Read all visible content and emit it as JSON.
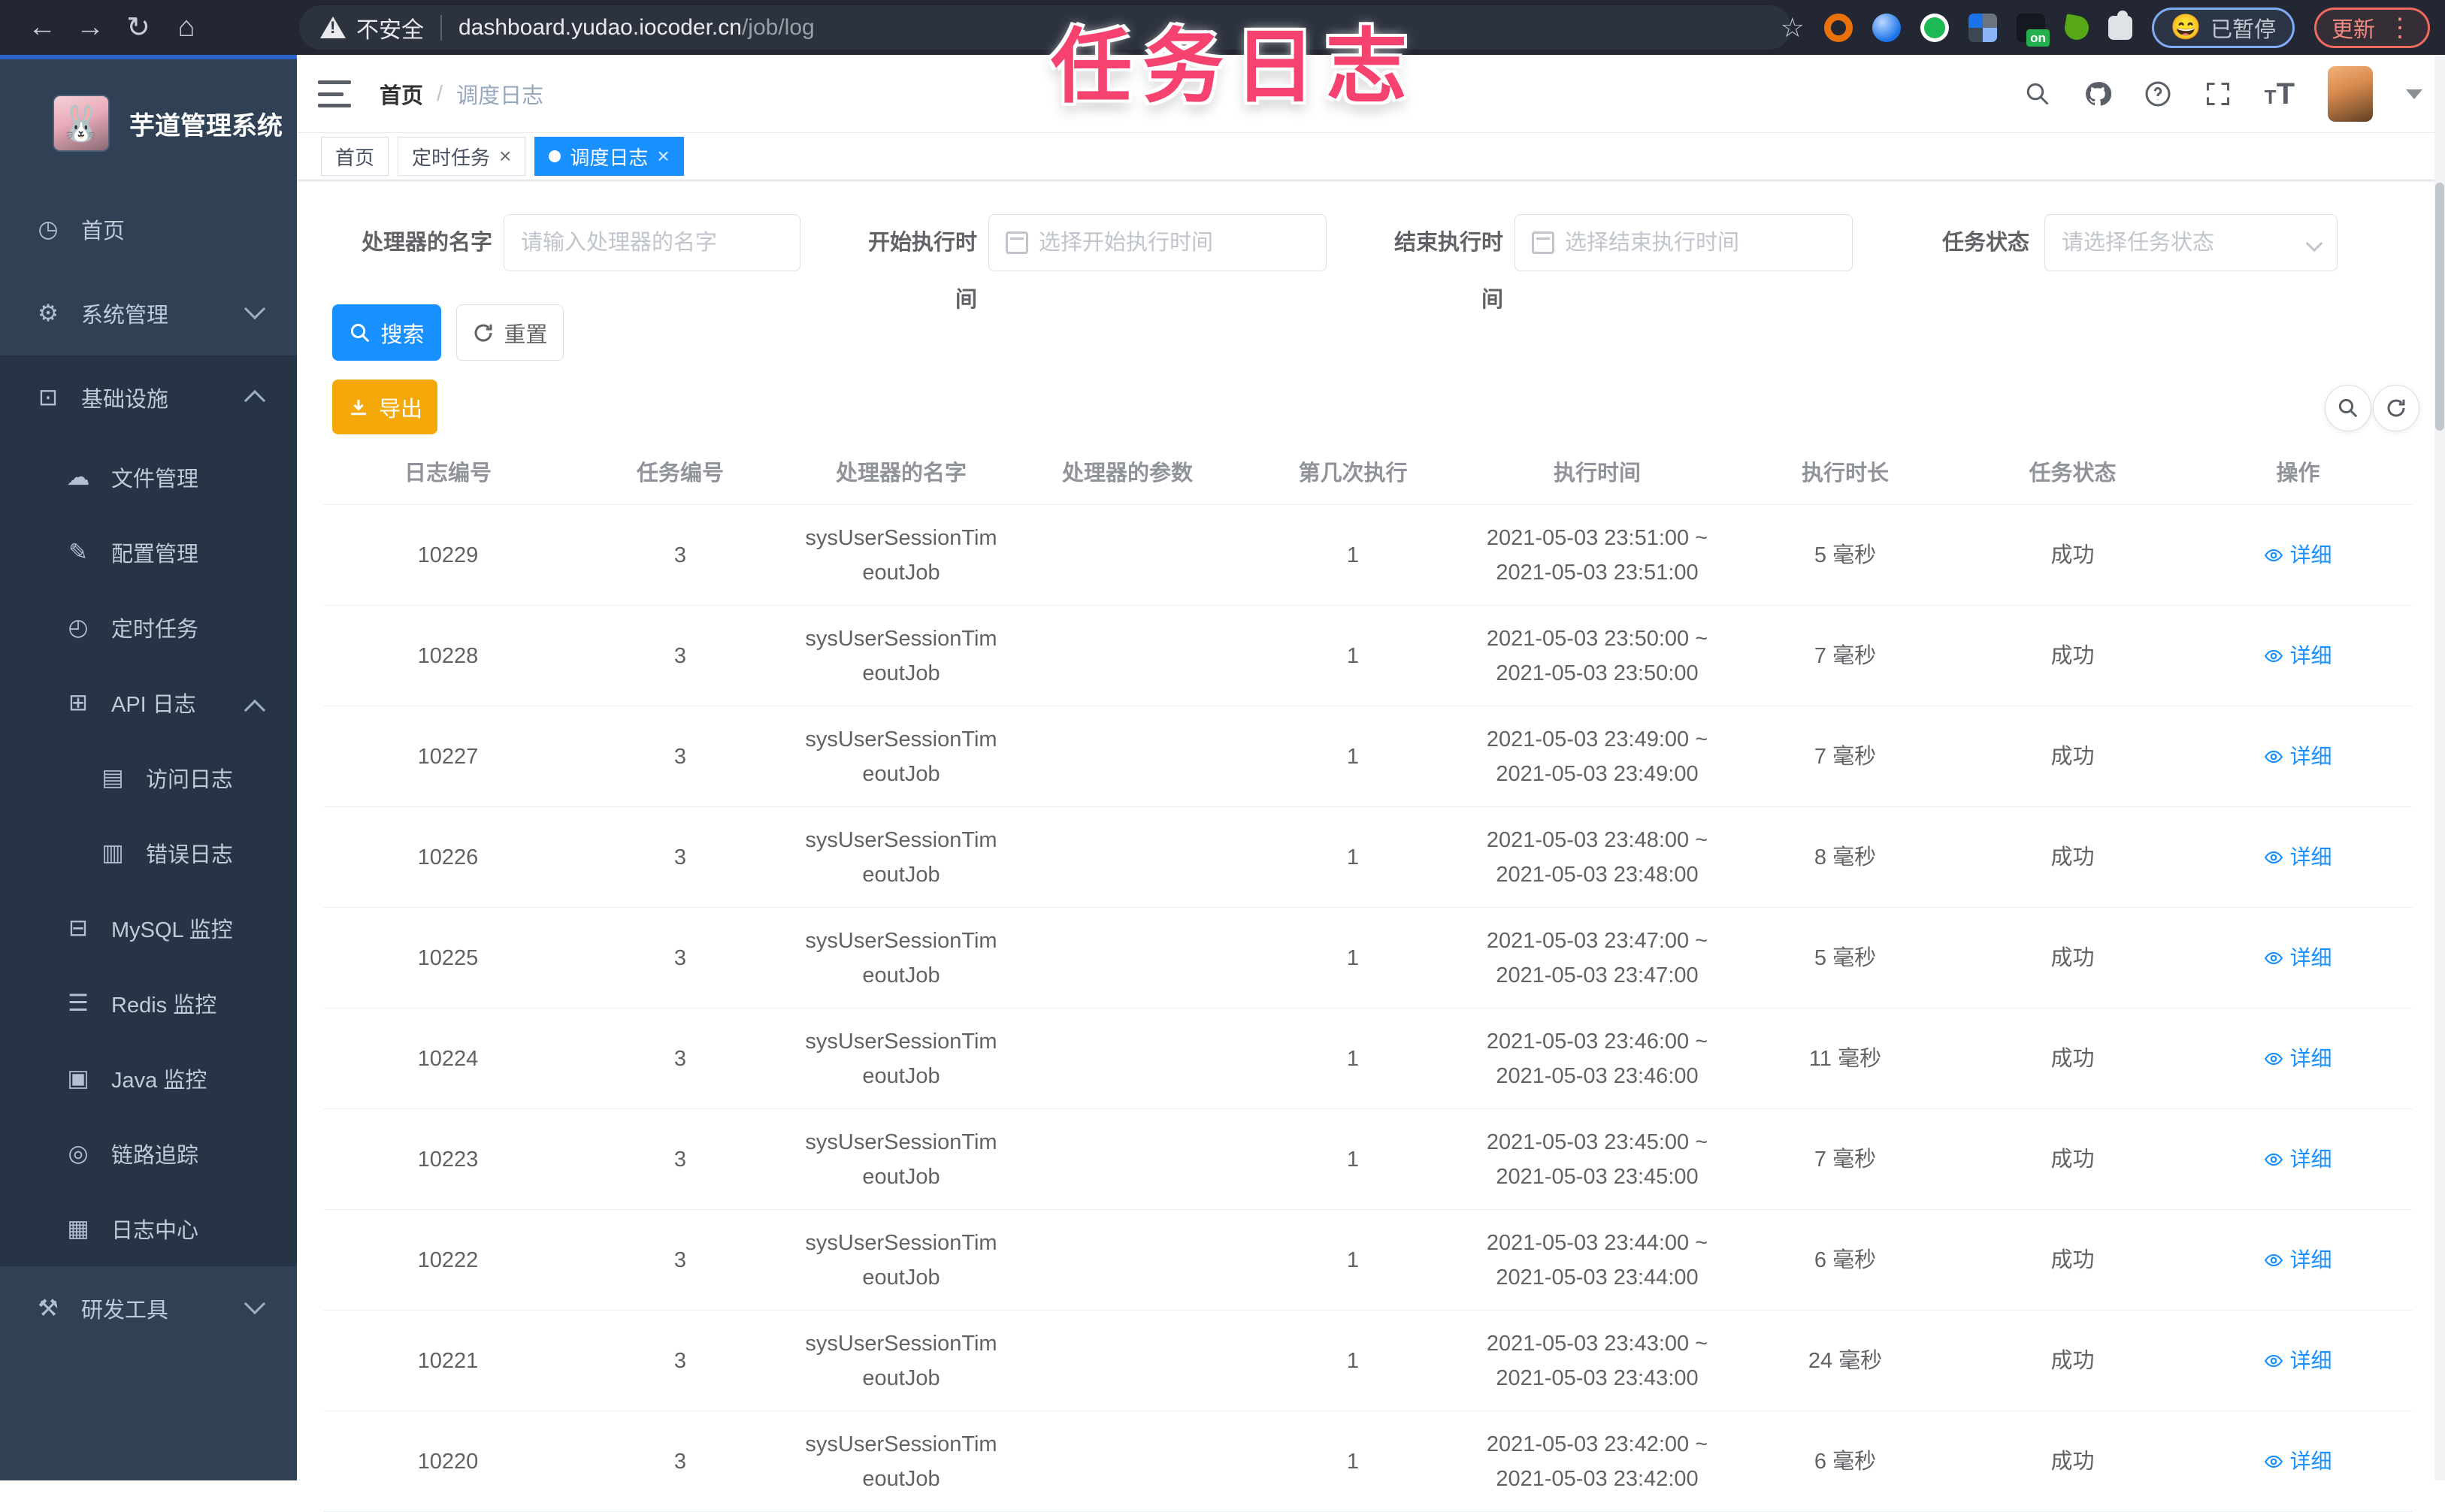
{
  "annotation": {
    "text": "任务日志"
  },
  "chrome": {
    "security_label": "不安全",
    "url_host": "dashboard.yudao.iocoder.cn",
    "url_path": "/job/log",
    "paused_badge": {
      "emoji": "😄",
      "label": "已暂停"
    },
    "update_label": "更新",
    "extension_on_badge": "on",
    "extensions": [
      {
        "icon": "extension-orange-ring-icon",
        "kind": "ring"
      },
      {
        "icon": "extension-blue-bulb-icon",
        "kind": "bulb"
      },
      {
        "icon": "extension-green-y-icon",
        "kind": "y"
      },
      {
        "icon": "extension-grid-icon",
        "kind": "grid"
      },
      {
        "icon": "extension-on-badge-icon",
        "kind": "on"
      },
      {
        "icon": "extension-leaf-icon",
        "kind": "leaf"
      },
      {
        "icon": "extensions-puzzle-icon",
        "kind": "puzzle"
      }
    ]
  },
  "glyphs": {
    "back": "←",
    "forward": "→",
    "reload": "↻",
    "home": "⌂",
    "star": "☆",
    "kebab": "⋮",
    "close": "×",
    "refresh": "↻",
    "t_small": "T",
    "t_big": "T"
  },
  "sidebar": {
    "logo_title": "芋道管理系统",
    "logo_glyph": "🐰",
    "items": [
      {
        "name": "home",
        "icon": "gauge-icon",
        "glyph": "◷",
        "label": "首页",
        "level": 0,
        "chevron": "",
        "dark": false
      },
      {
        "name": "system",
        "icon": "gear-icon",
        "glyph": "⚙",
        "label": "系统管理",
        "level": 0,
        "chevron": "down",
        "dark": false
      },
      {
        "name": "infra",
        "icon": "monitor-icon",
        "glyph": "⊡",
        "label": "基础设施",
        "level": 0,
        "chevron": "up",
        "dark": true
      },
      {
        "name": "file",
        "icon": "cloud-upload-icon",
        "glyph": "☁",
        "label": "文件管理",
        "level": 1,
        "chevron": "",
        "dark": true
      },
      {
        "name": "config",
        "icon": "edit-icon",
        "glyph": "✎",
        "label": "配置管理",
        "level": 1,
        "chevron": "",
        "dark": true
      },
      {
        "name": "cron-job",
        "icon": "timer-icon",
        "glyph": "◴",
        "label": "定时任务",
        "level": 1,
        "chevron": "",
        "dark": true
      },
      {
        "name": "api-log",
        "icon": "log-icon",
        "glyph": "⊞",
        "label": "API 日志",
        "level": 1,
        "chevron": "up",
        "dark": true
      },
      {
        "name": "access-log",
        "icon": "log-icon",
        "glyph": "▤",
        "label": "访问日志",
        "level": 2,
        "chevron": "",
        "dark": true
      },
      {
        "name": "error-log",
        "icon": "log-icon",
        "glyph": "▥",
        "label": "错误日志",
        "level": 2,
        "chevron": "",
        "dark": true
      },
      {
        "name": "mysql",
        "icon": "database-icon",
        "glyph": "⊟",
        "label": "MySQL 监控",
        "level": 1,
        "chevron": "",
        "dark": true
      },
      {
        "name": "redis",
        "icon": "layers-icon",
        "glyph": "☰",
        "label": "Redis 监控",
        "level": 1,
        "chevron": "",
        "dark": true
      },
      {
        "name": "java",
        "icon": "java-monitor-icon",
        "glyph": "▣",
        "label": "Java 监控",
        "level": 1,
        "chevron": "",
        "dark": true
      },
      {
        "name": "trace",
        "icon": "eye-icon",
        "glyph": "◎",
        "label": "链路追踪",
        "level": 1,
        "chevron": "",
        "dark": true
      },
      {
        "name": "log-center",
        "icon": "log-icon",
        "glyph": "▦",
        "label": "日志中心",
        "level": 1,
        "chevron": "",
        "dark": true
      },
      {
        "name": "devtools",
        "icon": "toolbox-icon",
        "glyph": "⚒",
        "label": "研发工具",
        "level": 0,
        "chevron": "down",
        "dark": false
      }
    ]
  },
  "navbar": {
    "breadcrumb_home": "首页",
    "breadcrumb_sep": "/",
    "breadcrumb_current": "调度日志"
  },
  "tags": [
    {
      "label": "首页",
      "closable": false,
      "active": false
    },
    {
      "label": "定时任务",
      "closable": true,
      "active": false
    },
    {
      "label": "调度日志",
      "closable": true,
      "active": true
    }
  ],
  "filters": {
    "handler_label": "处理器的名字",
    "handler_placeholder": "请输入处理器的名字",
    "begin_label": "开始执行时间",
    "begin_placeholder": "选择开始执行时间",
    "end_label": "结束执行时间",
    "end_placeholder": "选择结束执行时间",
    "status_label": "任务状态",
    "status_placeholder": "请选择任务状态"
  },
  "actions": {
    "search": "搜索",
    "reset": "重置",
    "export": "导出"
  },
  "table": {
    "headers": [
      "日志编号",
      "任务编号",
      "处理器的名字",
      "处理器的参数",
      "第几次执行",
      "执行时间",
      "执行时长",
      "任务状态",
      "操作"
    ],
    "rows": [
      {
        "log_id": "10229",
        "task_id": "3",
        "handler": [
          "sysUserSessionTim",
          "eoutJob"
        ],
        "param": "",
        "count": "1",
        "time": [
          "2021-05-03 23:51:00 ~",
          "2021-05-03 23:51:00"
        ],
        "duration": "5 毫秒",
        "status": "成功",
        "action": "详细"
      },
      {
        "log_id": "10228",
        "task_id": "3",
        "handler": [
          "sysUserSessionTim",
          "eoutJob"
        ],
        "param": "",
        "count": "1",
        "time": [
          "2021-05-03 23:50:00 ~",
          "2021-05-03 23:50:00"
        ],
        "duration": "7 毫秒",
        "status": "成功",
        "action": "详细"
      },
      {
        "log_id": "10227",
        "task_id": "3",
        "handler": [
          "sysUserSessionTim",
          "eoutJob"
        ],
        "param": "",
        "count": "1",
        "time": [
          "2021-05-03 23:49:00 ~",
          "2021-05-03 23:49:00"
        ],
        "duration": "7 毫秒",
        "status": "成功",
        "action": "详细"
      },
      {
        "log_id": "10226",
        "task_id": "3",
        "handler": [
          "sysUserSessionTim",
          "eoutJob"
        ],
        "param": "",
        "count": "1",
        "time": [
          "2021-05-03 23:48:00 ~",
          "2021-05-03 23:48:00"
        ],
        "duration": "8 毫秒",
        "status": "成功",
        "action": "详细"
      },
      {
        "log_id": "10225",
        "task_id": "3",
        "handler": [
          "sysUserSessionTim",
          "eoutJob"
        ],
        "param": "",
        "count": "1",
        "time": [
          "2021-05-03 23:47:00 ~",
          "2021-05-03 23:47:00"
        ],
        "duration": "5 毫秒",
        "status": "成功",
        "action": "详细"
      },
      {
        "log_id": "10224",
        "task_id": "3",
        "handler": [
          "sysUserSessionTim",
          "eoutJob"
        ],
        "param": "",
        "count": "1",
        "time": [
          "2021-05-03 23:46:00 ~",
          "2021-05-03 23:46:00"
        ],
        "duration": "11 毫秒",
        "status": "成功",
        "action": "详细"
      },
      {
        "log_id": "10223",
        "task_id": "3",
        "handler": [
          "sysUserSessionTim",
          "eoutJob"
        ],
        "param": "",
        "count": "1",
        "time": [
          "2021-05-03 23:45:00 ~",
          "2021-05-03 23:45:00"
        ],
        "duration": "7 毫秒",
        "status": "成功",
        "action": "详细"
      },
      {
        "log_id": "10222",
        "task_id": "3",
        "handler": [
          "sysUserSessionTim",
          "eoutJob"
        ],
        "param": "",
        "count": "1",
        "time": [
          "2021-05-03 23:44:00 ~",
          "2021-05-03 23:44:00"
        ],
        "duration": "6 毫秒",
        "status": "成功",
        "action": "详细"
      },
      {
        "log_id": "10221",
        "task_id": "3",
        "handler": [
          "sysUserSessionTim",
          "eoutJob"
        ],
        "param": "",
        "count": "1",
        "time": [
          "2021-05-03 23:43:00 ~",
          "2021-05-03 23:43:00"
        ],
        "duration": "24 毫秒",
        "status": "成功",
        "action": "详细"
      },
      {
        "log_id": "10220",
        "task_id": "3",
        "handler": [
          "sysUserSessionTim",
          "eoutJob"
        ],
        "param": "",
        "count": "1",
        "time": [
          "2021-05-03 23:42:00 ~",
          "2021-05-03 23:42:00"
        ],
        "duration": "6 毫秒",
        "status": "成功",
        "action": "详细"
      }
    ]
  },
  "colors": {
    "accent_blue": "#1890ff",
    "warning_yellow": "#f5a80a",
    "sidebar_bg": "#304156",
    "sidebar_dark_bg": "#263445",
    "annotation_pink": "#f5426e"
  }
}
